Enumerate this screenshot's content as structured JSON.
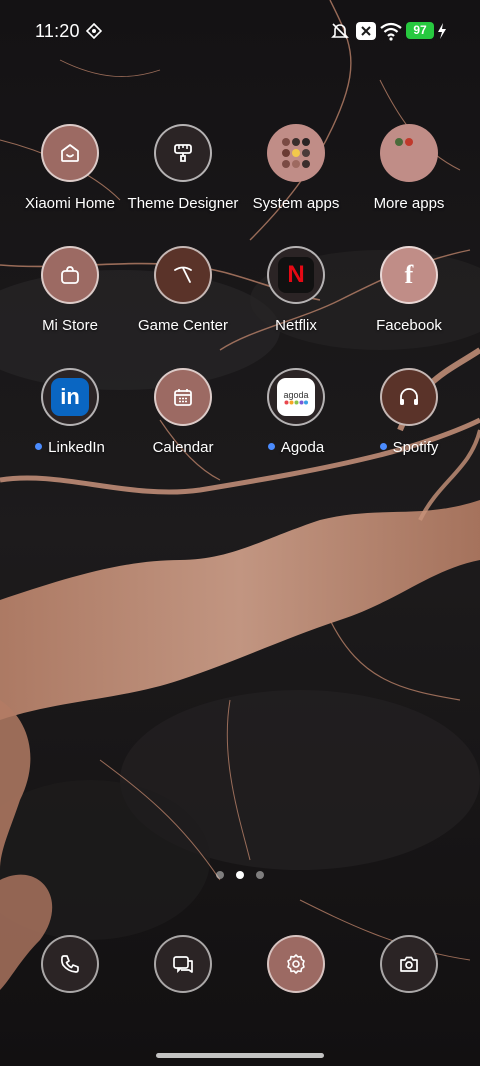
{
  "status_bar": {
    "time": "11:20",
    "battery_level": "97",
    "icons": [
      "vpn-icon",
      "mute-icon",
      "close-notification-icon",
      "wifi-icon",
      "battery-icon",
      "charging-icon"
    ]
  },
  "apps": [
    {
      "label": "Xiaomi Home",
      "icon": "home-icon",
      "dot": false
    },
    {
      "label": "Theme Designer",
      "icon": "paint-roller-icon",
      "dot": false
    },
    {
      "label": "System apps",
      "icon": "folder-icon",
      "dot": false
    },
    {
      "label": "More apps",
      "icon": "folder-icon",
      "dot": false
    },
    {
      "label": "Mi Store",
      "icon": "shopping-bag-icon",
      "dot": false
    },
    {
      "label": "Game Center",
      "icon": "pickaxe-icon",
      "dot": false
    },
    {
      "label": "Netflix",
      "icon": "netflix-icon",
      "glyph": "N",
      "dot": false
    },
    {
      "label": "Facebook",
      "icon": "facebook-icon",
      "glyph": "f",
      "dot": false
    },
    {
      "label": "LinkedIn",
      "icon": "linkedin-icon",
      "glyph": "in",
      "dot": true
    },
    {
      "label": "Calendar",
      "icon": "calendar-icon",
      "dot": false
    },
    {
      "label": "Agoda",
      "icon": "agoda-icon",
      "glyph": "agoda",
      "dot": true
    },
    {
      "label": "Spotify",
      "icon": "headphones-icon",
      "dot": true
    }
  ],
  "page_indicator": {
    "total": 3,
    "active": 2
  },
  "dock": [
    {
      "name": "phone",
      "icon": "phone-icon"
    },
    {
      "name": "messages",
      "icon": "message-icon"
    },
    {
      "name": "settings",
      "icon": "gear-icon"
    },
    {
      "name": "camera",
      "icon": "camera-icon"
    }
  ],
  "colors": {
    "accent": "#9c6a63",
    "battery": "#27c93f",
    "notification_dot": "#4b8cff",
    "netflix_red": "#e50914",
    "linkedin_blue": "#0a66c2"
  }
}
